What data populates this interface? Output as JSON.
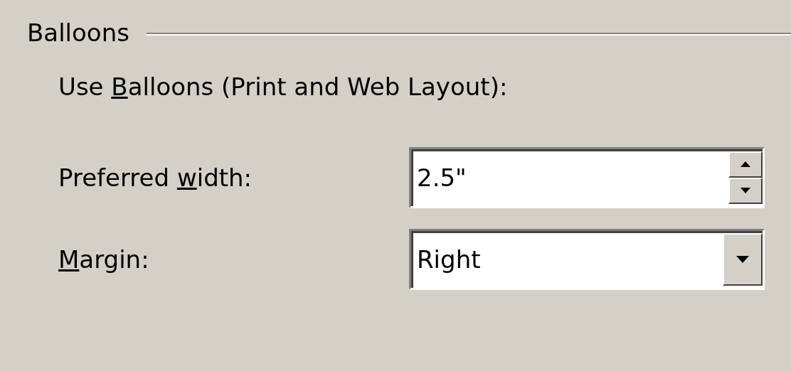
{
  "group": {
    "title": "Balloons"
  },
  "use_balloons": {
    "label_before": "Use ",
    "access_key": "B",
    "label_after": "alloons (Print and Web Layout):"
  },
  "preferred_width": {
    "label_before": "Preferred ",
    "access_key": "w",
    "label_after": "idth:",
    "value": "2.5\""
  },
  "margin": {
    "access_key": "M",
    "label_after": "argin:",
    "value": "Right"
  }
}
